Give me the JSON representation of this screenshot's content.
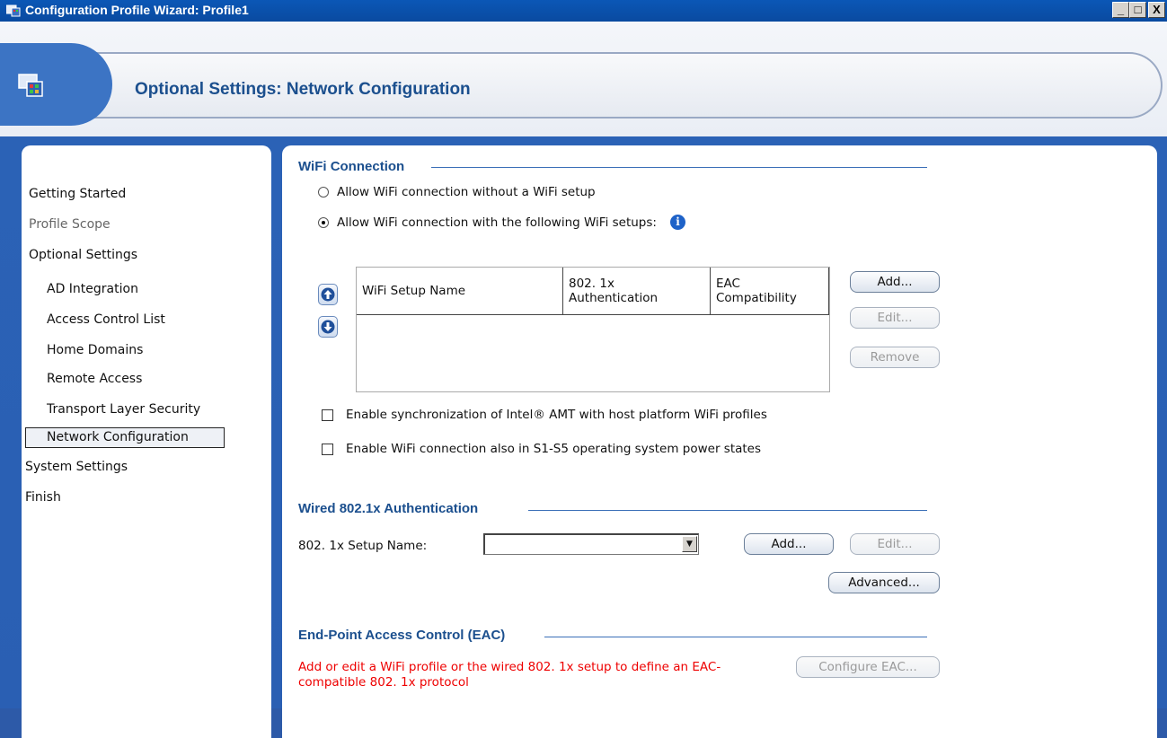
{
  "window": {
    "title": "Configuration Profile Wizard: Profile1",
    "minimize": "_",
    "maximize": "□",
    "close": "X"
  },
  "header": {
    "title": "Optional Settings: Network Configuration"
  },
  "nav": {
    "items": [
      {
        "label": "Getting Started"
      },
      {
        "label": "Profile Scope"
      },
      {
        "label": "Optional Settings"
      },
      {
        "label": "AD Integration"
      },
      {
        "label": "Access Control List"
      },
      {
        "label": "Home Domains"
      },
      {
        "label": "Remote Access"
      },
      {
        "label": "Transport Layer Security"
      },
      {
        "label": "Network Configuration"
      },
      {
        "label": "System Settings"
      },
      {
        "label": "Finish"
      }
    ]
  },
  "wifi": {
    "section_title": "WiFi Connection",
    "radio_without": "Allow WiFi connection without a WiFi setup",
    "radio_with": "Allow WiFi connection with the following WiFi setups:",
    "selected_option": "with",
    "table": {
      "columns": [
        "WiFi Setup Name",
        "802. 1x\nAuthentication",
        "EAC\nCompatibility"
      ],
      "rows": []
    },
    "add_label": "Add...",
    "edit_label": "Edit...",
    "remove_label": "Remove",
    "sync_label": "Enable synchronization of Intel® AMT with host platform WiFi profiles",
    "s1s5_label": "Enable WiFi connection also in S1-S5 operating system power states"
  },
  "wired": {
    "section_title": "Wired 802.1x Authentication",
    "setup_name_label": "802. 1x Setup Name:",
    "setup_name_value": "",
    "add_label": "Add...",
    "edit_label": "Edit...",
    "advanced_label": "Advanced..."
  },
  "eac": {
    "section_title": "End-Point Access Control (EAC)",
    "message": "Add or edit a WiFi profile or the wired 802. 1x setup to define an EAC-compatible 802. 1x protocol",
    "configure_label": "Configure EAC..."
  }
}
